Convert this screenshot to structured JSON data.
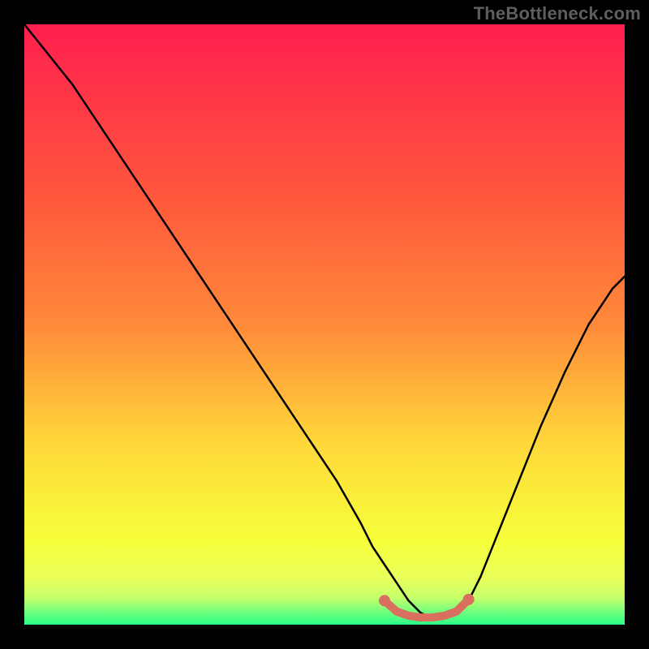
{
  "watermark": "TheBottleneck.com",
  "colors": {
    "background": "#000000",
    "curve": "#000000",
    "marker": "#d9705f",
    "gradient_top": "#ff1f4f",
    "gradient_mid_upper": "#ff8a3a",
    "gradient_mid": "#ffd83a",
    "gradient_mid_lower": "#f6ff3a",
    "gradient_near_bottom": "#c6ff6a",
    "gradient_bottom": "#2bff88"
  },
  "chart_data": {
    "type": "line",
    "title": "",
    "xlabel": "",
    "ylabel": "",
    "xlim": [
      0,
      100
    ],
    "ylim": [
      0,
      100
    ],
    "series": [
      {
        "name": "bottleneck-curve",
        "x": [
          0,
          4,
          8,
          12,
          16,
          20,
          24,
          28,
          32,
          36,
          40,
          44,
          48,
          52,
          56,
          58,
          60,
          62,
          64,
          66,
          68,
          70,
          72,
          74,
          76,
          78,
          82,
          86,
          90,
          94,
          98,
          100
        ],
        "y": [
          100,
          95,
          90,
          84,
          78,
          72,
          66,
          60,
          54,
          48,
          42,
          36,
          30,
          24,
          17,
          13,
          10,
          7,
          4,
          2,
          1,
          1,
          2,
          4,
          8,
          13,
          23,
          33,
          42,
          50,
          56,
          58
        ]
      }
    ],
    "markers": {
      "name": "optimal-range",
      "x": [
        60,
        62,
        64,
        66,
        68,
        70,
        72,
        74
      ],
      "y": [
        4,
        2.2,
        1.5,
        1.2,
        1.2,
        1.5,
        2.2,
        4.2
      ]
    },
    "annotations": []
  }
}
